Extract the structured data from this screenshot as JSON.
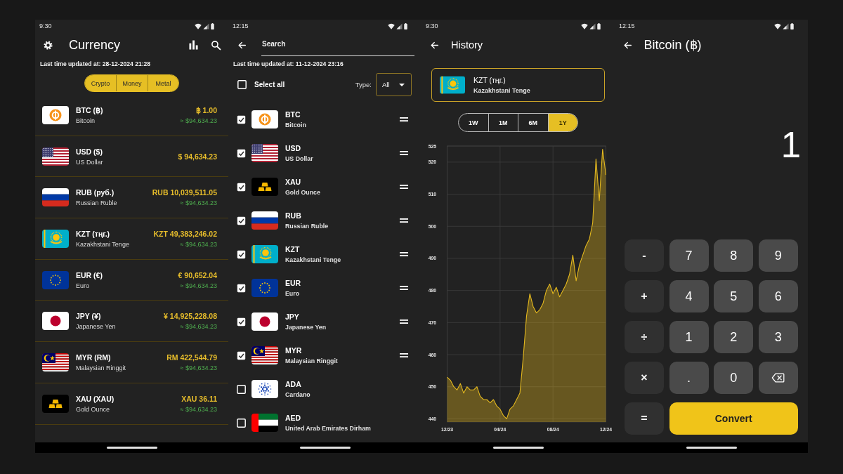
{
  "currency_screen": {
    "status_bar": {
      "time": "9:30"
    },
    "title": "Currency",
    "last_updated": "Last time updated at: 28-12-2024 21:28",
    "filters": [
      {
        "label": "Crypto",
        "selected": true
      },
      {
        "label": "Money",
        "selected": true
      },
      {
        "label": "Metal",
        "selected": true
      }
    ],
    "rows": [
      {
        "code": "BTC (฿)",
        "name": "Bitcoin",
        "amount": "฿ 1.00",
        "usd_value": "≈ $94,634.23"
      },
      {
        "code": "USD ($)",
        "name": "US Dollar",
        "amount": "$ 94,634.23"
      },
      {
        "code": "RUB (руб.)",
        "name": "Russian Ruble",
        "amount": "RUB 10,039,511.05",
        "usd_value": "≈ $94,634.23"
      },
      {
        "code": "KZT (тңг.)",
        "name": "Kazakhstani Tenge",
        "amount": "KZT 49,383,246.02",
        "usd_value": "≈ $94,634.23"
      },
      {
        "code": "EUR (€)",
        "name": "Euro",
        "amount": "€ 90,652.04",
        "usd_value": "≈ $94,634.23"
      },
      {
        "code": "JPY (¥)",
        "name": "Japanese Yen",
        "amount": "¥ 14,925,228.08",
        "usd_value": "≈ $94,634.23"
      },
      {
        "code": "MYR (RM)",
        "name": "Malaysian Ringgit",
        "amount": "RM 422,544.79",
        "usd_value": "≈ $94,634.23"
      },
      {
        "code": "XAU (XAU)",
        "name": "Gold Ounce",
        "amount": "XAU 36.11",
        "usd_value": "≈ $94,634.23"
      }
    ]
  },
  "search_screen": {
    "status_bar": {
      "time": "12:15"
    },
    "search": {
      "placeholder": "Search"
    },
    "last_updated": "Last time updated at: 11-12-2024 23:16",
    "select_all": {
      "label": "Select all",
      "checked": false
    },
    "type_filter": {
      "label": "Type:",
      "value": "All"
    },
    "rows": [
      {
        "code": "BTC",
        "name": "Bitcoin",
        "checked": true
      },
      {
        "code": "USD",
        "name": "US Dollar",
        "checked": true
      },
      {
        "code": "XAU",
        "name": "Gold Ounce",
        "checked": true
      },
      {
        "code": "RUB",
        "name": "Russian Ruble",
        "checked": true
      },
      {
        "code": "KZT",
        "name": "Kazakhstani Tenge",
        "checked": true
      },
      {
        "code": "EUR",
        "name": "Euro",
        "checked": true
      },
      {
        "code": "JPY",
        "name": "Japanese Yen",
        "checked": true
      },
      {
        "code": "MYR",
        "name": "Malaysian Ringgit",
        "checked": true
      },
      {
        "code": "ADA",
        "name": "Cardano",
        "checked": false
      },
      {
        "code": "AED",
        "name": "United Arab Emirates Dirham",
        "checked": false
      }
    ]
  },
  "history_screen": {
    "status_bar": {
      "time": "9:30"
    },
    "title": "History",
    "currency": {
      "code": "KZT (тңг.)",
      "name": "Kazakhstani Tenge"
    },
    "ranges": [
      {
        "label": "1W",
        "selected": false
      },
      {
        "label": "1M",
        "selected": false
      },
      {
        "label": "6M",
        "selected": false
      },
      {
        "label": "1Y",
        "selected": true
      }
    ],
    "chart_data": {
      "type": "area",
      "categories": [
        "12/23",
        null,
        null,
        null,
        null,
        null,
        null,
        null,
        null,
        null,
        null,
        null,
        null,
        null,
        null,
        null,
        "04/24",
        null,
        null,
        null,
        null,
        null,
        null,
        null,
        null,
        null,
        null,
        null,
        null,
        null,
        null,
        null,
        "08/24",
        null,
        null,
        null,
        null,
        null,
        null,
        null,
        null,
        null,
        null,
        null,
        null,
        null,
        null,
        null,
        "12/24"
      ],
      "series": [
        {
          "color": "#e3b81f",
          "values": [
            453,
            452,
            450,
            449,
            451,
            448,
            450,
            449,
            449,
            450,
            447,
            446,
            446,
            445,
            446,
            444,
            443,
            441,
            440,
            443,
            444,
            446,
            448,
            459,
            472,
            479,
            475,
            473,
            474,
            476,
            480,
            482,
            479,
            481,
            478,
            480,
            482,
            485,
            491,
            483,
            488,
            491,
            494,
            496,
            501,
            521,
            508,
            524,
            516
          ]
        }
      ],
      "ylim": [
        439,
        525
      ],
      "yticks": [
        440,
        450,
        460,
        470,
        480,
        490,
        500,
        510,
        520,
        525
      ],
      "grid": true
    }
  },
  "converter_screen": {
    "status_bar": {
      "time": "12:15"
    },
    "title": "Bitcoin (฿)",
    "display": "1",
    "keys": [
      {
        "label": "-",
        "kind": "operator"
      },
      {
        "label": "7",
        "kind": "digit"
      },
      {
        "label": "8",
        "kind": "digit"
      },
      {
        "label": "9",
        "kind": "digit"
      },
      {
        "label": "+",
        "kind": "operator"
      },
      {
        "label": "4",
        "kind": "digit"
      },
      {
        "label": "5",
        "kind": "digit"
      },
      {
        "label": "6",
        "kind": "digit"
      },
      {
        "label": "÷",
        "kind": "operator"
      },
      {
        "label": "1",
        "kind": "digit"
      },
      {
        "label": "2",
        "kind": "digit"
      },
      {
        "label": "3",
        "kind": "digit"
      },
      {
        "label": "×",
        "kind": "operator"
      },
      {
        "label": ".",
        "kind": "digit"
      },
      {
        "label": "0",
        "kind": "digit"
      },
      {
        "kind": "backspace"
      },
      {
        "label": "=",
        "kind": "operator"
      },
      {
        "label": "Convert",
        "kind": "action"
      }
    ]
  }
}
